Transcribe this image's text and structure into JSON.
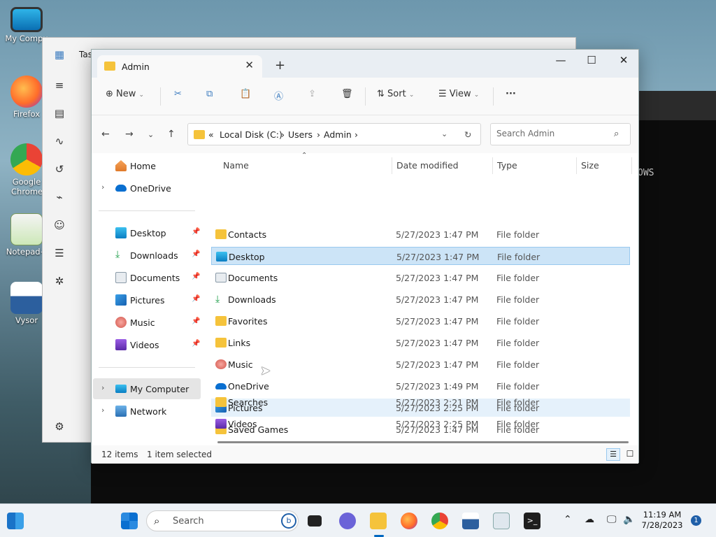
{
  "desktop_icons": [
    {
      "label": "My Compu"
    },
    {
      "label": "Firefox"
    },
    {
      "label": "Google Chrome"
    },
    {
      "label": "Notepad+"
    },
    {
      "label": "Vysor"
    }
  ],
  "background_windows": {
    "task_manager_title": "Tas",
    "terminal_text": "OWS"
  },
  "explorer": {
    "tab_title": "Admin",
    "toolbar": {
      "new_label": "New",
      "sort_label": "Sort",
      "view_label": "View",
      "more_label": "···"
    },
    "address": {
      "overflow": "«",
      "crumbs": [
        "Local Disk (C:)",
        "Users",
        "Admin"
      ],
      "search_placeholder": "Search Admin"
    },
    "nav": {
      "home": "Home",
      "onedrive": "OneDrive",
      "quick": [
        "Desktop",
        "Downloads",
        "Documents",
        "Pictures",
        "Music",
        "Videos"
      ],
      "my_computer": "My Computer",
      "network": "Network"
    },
    "columns": {
      "name": "Name",
      "date": "Date modified",
      "type": "Type",
      "size": "Size"
    },
    "files": [
      {
        "name": "Contacts",
        "date": "5/27/2023 1:47 PM",
        "type": "File folder",
        "icon": "folder-icon"
      },
      {
        "name": "Desktop",
        "date": "5/27/2023 1:47 PM",
        "type": "File folder",
        "icon": "desktop-folder-icon"
      },
      {
        "name": "Documents",
        "date": "5/27/2023 1:47 PM",
        "type": "File folder",
        "icon": "documents-folder-icon"
      },
      {
        "name": "Downloads",
        "date": "5/27/2023 1:47 PM",
        "type": "File folder",
        "icon": "downloads-folder-icon"
      },
      {
        "name": "Favorites",
        "date": "5/27/2023 1:47 PM",
        "type": "File folder",
        "icon": "folder-icon"
      },
      {
        "name": "Links",
        "date": "5/27/2023 1:47 PM",
        "type": "File folder",
        "icon": "folder-icon"
      },
      {
        "name": "Music",
        "date": "5/27/2023 1:47 PM",
        "type": "File folder",
        "icon": "music-folder-icon"
      },
      {
        "name": "OneDrive",
        "date": "5/27/2023 1:49 PM",
        "type": "File folder",
        "icon": "onedrive-folder-icon"
      },
      {
        "name": "Pictures",
        "date": "5/27/2023 2:25 PM",
        "type": "File folder",
        "icon": "pictures-folder-icon"
      },
      {
        "name": "Saved Games",
        "date": "5/27/2023 1:47 PM",
        "type": "File folder",
        "icon": "folder-icon"
      },
      {
        "name": "Searches",
        "date": "5/27/2023 2:21 PM",
        "type": "File folder",
        "icon": "folder-icon"
      },
      {
        "name": "Videos",
        "date": "5/27/2023 2:25 PM",
        "type": "File folder",
        "icon": "videos-folder-icon"
      }
    ],
    "status": {
      "count": "12 items",
      "selection": "1 item selected"
    }
  },
  "taskbar": {
    "search_placeholder": "Search",
    "time": "11:19 AM",
    "date": "7/28/2023",
    "notification_count": "1"
  },
  "colors": {
    "selection": "#cce4f7",
    "folder": "#f5c33b",
    "accent": "#0067c0"
  }
}
